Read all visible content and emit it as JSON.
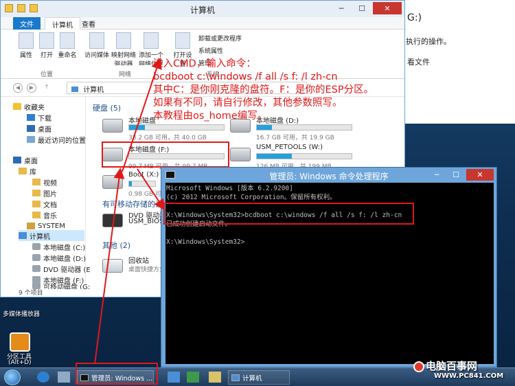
{
  "background_window": {
    "line1": "G:)",
    "line2": "执行的操作。",
    "line3": "看文件"
  },
  "explorer": {
    "title": "计算机",
    "tabs": [
      "文件",
      "计算机",
      "查看"
    ],
    "ribbon": {
      "buttons": [
        "属性",
        "打开",
        "重命名",
        "访问媒体",
        "映射网络驱动器",
        "添加一个网络位置",
        "打开设置"
      ],
      "small_items": [
        "卸载或更改程序",
        "系统属性",
        "管理"
      ],
      "groups": [
        "位置",
        "网络",
        "系统"
      ]
    },
    "address": "计算机",
    "nav": {
      "favorites": "收藏夹",
      "downloads": "下载",
      "desktop": "桌面",
      "recent": "最近访问的位置",
      "desktop2": "桌面",
      "library": "库",
      "videos": "视频",
      "pictures": "图片",
      "documents": "文档",
      "music": "音乐",
      "system": "SYSTEM",
      "computer": "计算机",
      "drive_c": "本地磁盘 (C:)",
      "drive_d": "本地磁盘 (D:)",
      "drive_dvd": "DVD 驱动器 (E",
      "drive_f": "本地磁盘 (F:)",
      "drive_g": "可移动磁盘 (G:"
    },
    "sections": {
      "hdd": "硬盘 (5)",
      "removable": "有可移动存储的设",
      "other": "其他 (2)"
    },
    "drives": [
      {
        "name": "本地磁盘",
        "info": "33.2 GB 可用，共 40.0 GB",
        "used": 0.17
      },
      {
        "name": "本地磁盘 (D:)",
        "info": "16.7 GB 可用，共 19.9 GB",
        "used": 0.16
      },
      {
        "name": "本地磁盘 (F:)",
        "info": "99.7 MB 可用，共 99.7 MB",
        "used": 0.0
      },
      {
        "name": "USM_PETOOLS (W:)",
        "info": "126 MB 可用，共 199 MB",
        "used": 0.37
      },
      {
        "name": "Boot (X:)",
        "info": "0.98 GB 可用",
        "used": 0.1
      }
    ],
    "dvd": {
      "name": "DVD 驱动器",
      "label": "USM_BIOS"
    },
    "recycle": {
      "name": "回收站",
      "label": "桌面快捷方式"
    },
    "status": "9 个项目"
  },
  "annotation": {
    "lines": [
      "进入CMD，输入命令：",
      "bcdboot c:\\windows /f all /s f: /l zh-cn",
      "其中C：是你刚克隆的盘符。F：是你的ESP分区。",
      "如果有不同，请自行修改，其他参数照写。",
      "本教程由os_home编写。"
    ]
  },
  "cmd": {
    "title": "管理员: Windows 命令处理程序",
    "lines": [
      "Microsoft Windows [版本 6.2.9200]",
      "(c) 2012 Microsoft Corporation。保留所有权利。",
      "",
      "X:\\Windows\\System32>bcdboot c:\\windows /f all /s f: /l zh-cn",
      "已成功创建启动文件。",
      "",
      "X:\\Windows\\System32>"
    ]
  },
  "desktop": {
    "media_player": "多媒体播放器",
    "partition_tool": "分区工具",
    "partition_tool_shortcut": "(Alt+D)"
  },
  "taskbar": {
    "cmd_item": "管理员: Windows ...",
    "explorer_item": "计算机"
  },
  "watermark": {
    "brand": "电脑百事网",
    "url": "WWW.PC841.COM"
  },
  "colors": {
    "annotation": "#e01818",
    "highlight": "#e01818",
    "cmd_frame": "#6ea6db",
    "drive_bar": "#26a0da"
  }
}
